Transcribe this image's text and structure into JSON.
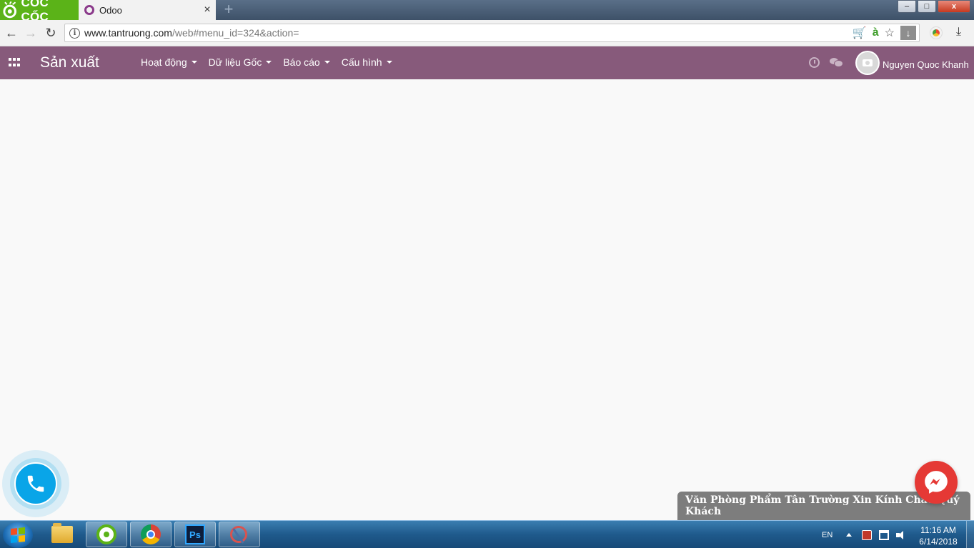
{
  "browser": {
    "brand_label": "CỐC CỐC",
    "tab": {
      "title": "Odoo",
      "close_label": "×"
    },
    "new_tab_label": "+",
    "window_controls": {
      "minimize": "–",
      "maximize": "□",
      "close": "x"
    },
    "address_bar": {
      "host": "www.tantruong.com",
      "path": "/web#menu_id=324&action="
    }
  },
  "odoo": {
    "app_title": "Sản xuất",
    "menu": [
      {
        "label": "Hoạt động"
      },
      {
        "label": "Dữ liệu Gốc"
      },
      {
        "label": "Báo cáo"
      },
      {
        "label": "Cấu hình"
      }
    ],
    "user_name": "Nguyen Quoc Khanh",
    "brand_color": "#875a7b"
  },
  "widgets": {
    "greeting": "Văn Phòng Phẩm Tân Trường Xin Kính Chào Quý Khách",
    "phone_color": "#09a5e8",
    "messenger_color": "#e53935"
  },
  "taskbar": {
    "apps": [
      {
        "name": "windows-explorer"
      },
      {
        "name": "coc-coc-browser"
      },
      {
        "name": "google-chrome"
      },
      {
        "name": "photoshop",
        "label": "Ps"
      },
      {
        "name": "snipping-tool"
      }
    ],
    "language": "EN",
    "time": "11:16 AM",
    "date": "6/14/2018"
  }
}
